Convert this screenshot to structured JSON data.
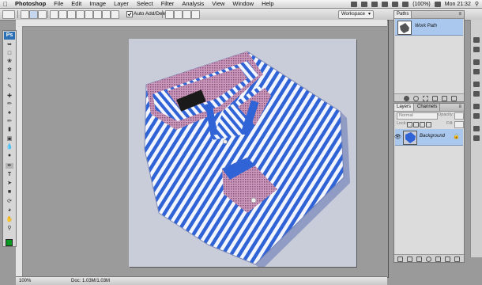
{
  "menubar": {
    "app_name": "Photoshop",
    "items": [
      "File",
      "Edit",
      "Image",
      "Layer",
      "Select",
      "Filter",
      "Analysis",
      "View",
      "Window",
      "Help"
    ],
    "battery": "(100%)",
    "clock": "Mon 21:32"
  },
  "options_bar": {
    "auto_add_delete_label": "Auto Add/Delete",
    "auto_add_delete_checked": true,
    "workspace_label": "Workspace"
  },
  "tools": {
    "logo": "Ps",
    "items": [
      "move-tool",
      "marquee-tool",
      "lasso-tool",
      "quick-select-tool",
      "crop-tool",
      "eyedropper-tool",
      "healing-brush-tool",
      "brush-tool",
      "clone-stamp-tool",
      "history-brush-tool",
      "eraser-tool",
      "gradient-tool",
      "blur-tool",
      "dodge-tool",
      "pen-tool",
      "type-tool",
      "path-selection-tool",
      "shape-tool",
      "3d-rotate-tool",
      "3d-orbit-tool",
      "hand-tool",
      "zoom-tool"
    ],
    "foreground_color": "#0a9a22"
  },
  "status": {
    "zoom": "100%",
    "doc_size": "Doc: 1.03M/1.03M"
  },
  "paths_panel": {
    "tab": "Paths",
    "items": [
      {
        "label": "Work Path",
        "selected": true
      }
    ]
  },
  "layers_panel": {
    "tabs": [
      "Layers",
      "Channels"
    ],
    "blend_mode": "Normal",
    "opacity_label": "Opacity:",
    "lock_label": "Lock:",
    "fill_label": "Fill:",
    "layers": [
      {
        "name": "Background",
        "visible": true,
        "locked": true,
        "selected": true
      }
    ]
  },
  "colors": {
    "accent_selection": "#aac8ee",
    "shirt_blue": "#2f63d6",
    "shirt_white": "#f4f6ff",
    "collar_pink": "#a8689a"
  }
}
